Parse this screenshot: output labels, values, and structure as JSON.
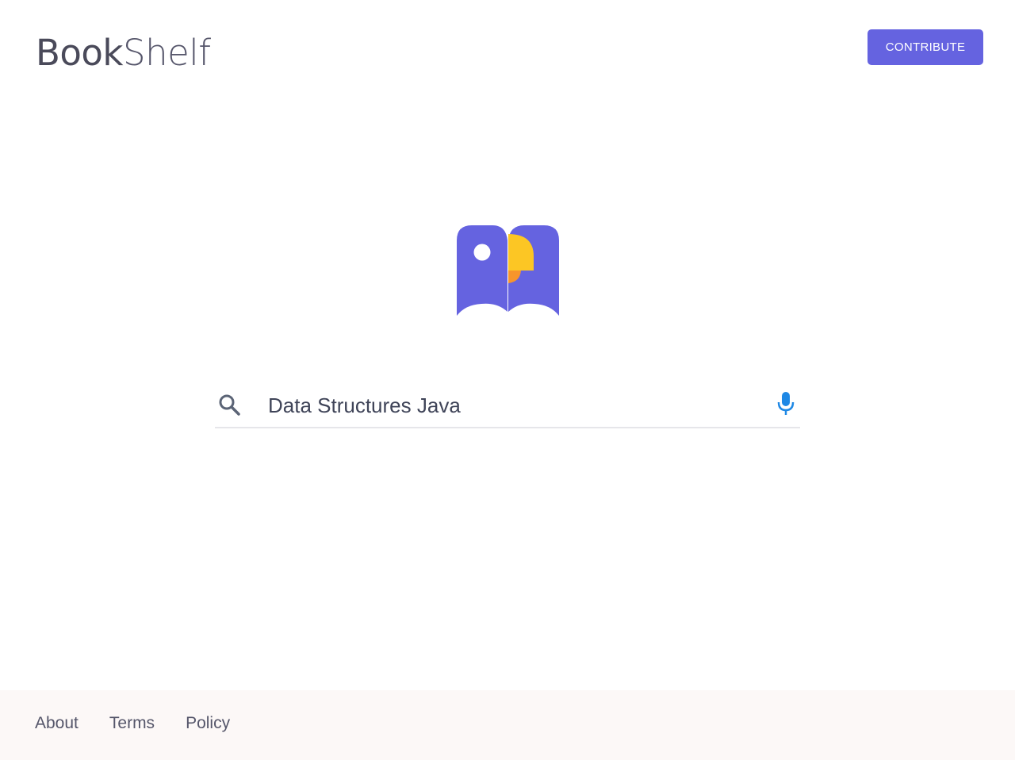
{
  "header": {
    "brand_part_a": "Book",
    "brand_part_b": "Shelf",
    "contribute_label": "CONTRIBUTE"
  },
  "search": {
    "value": "Data Structures Java",
    "icon": "search-icon",
    "mic_icon": "microphone-icon"
  },
  "footer": {
    "links": [
      "About",
      "Terms",
      "Policy"
    ]
  },
  "colors": {
    "accent": "#6563e0",
    "logo_yellow": "#fcc624",
    "logo_orange": "#f7952b",
    "mic_blue": "#1e88e5",
    "footer_bg": "#fcf8f7"
  }
}
